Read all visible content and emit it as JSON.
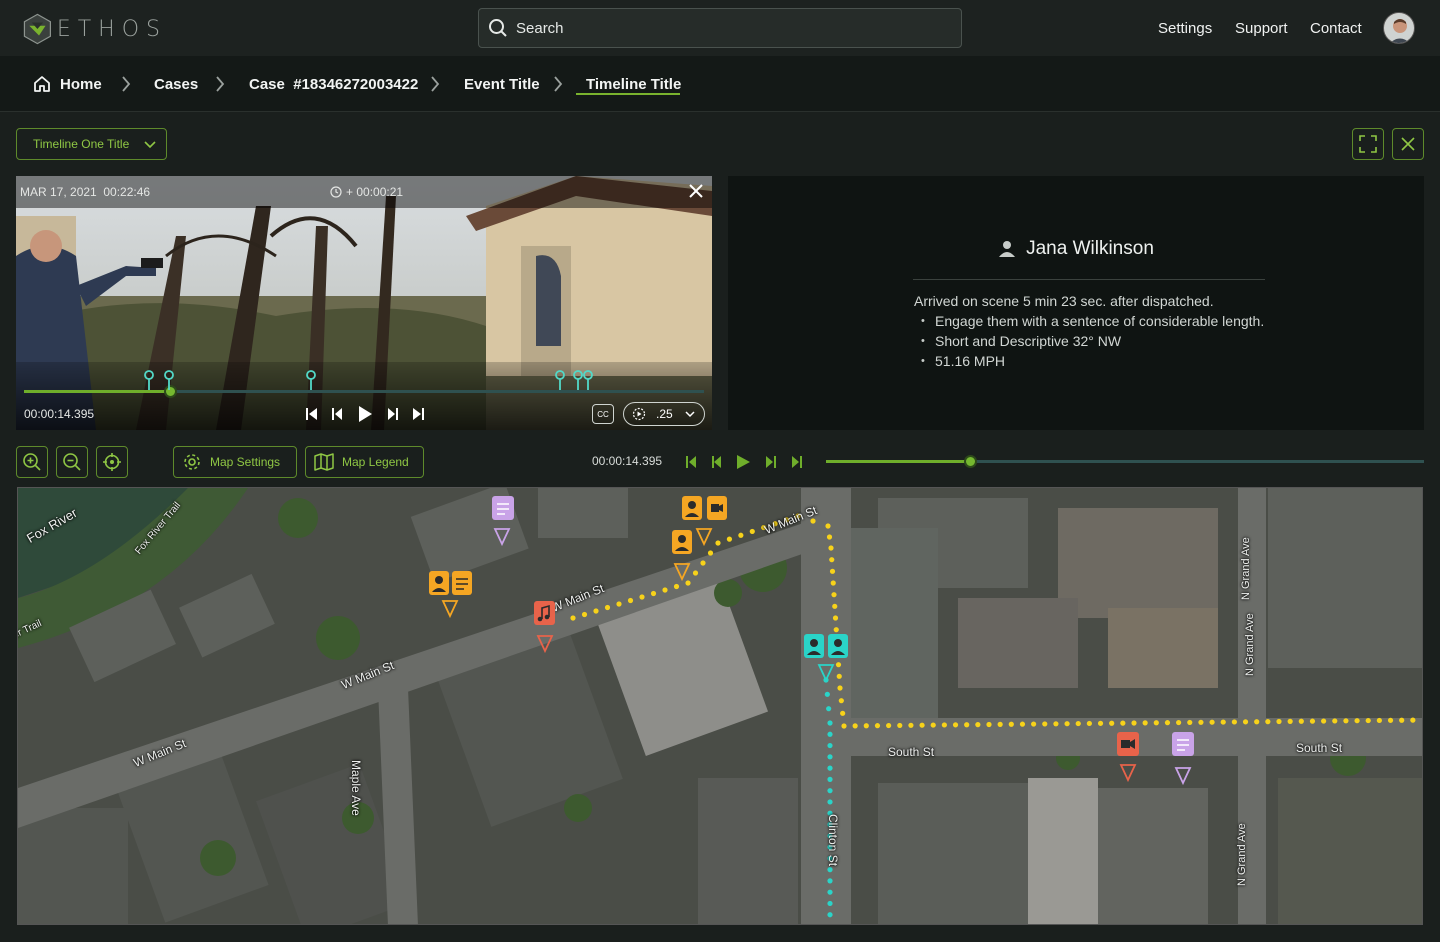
{
  "app": {
    "logo_text": "ETHOS"
  },
  "search": {
    "placeholder": "Search"
  },
  "topnav": {
    "settings": "Settings",
    "support": "Support",
    "contact": "Contact"
  },
  "breadcrumbs": {
    "home": "Home",
    "cases": "Cases",
    "case": "Case  #18346272003422",
    "event": "Event Title",
    "timeline": "Timeline Title"
  },
  "timeline_select": {
    "value": "Timeline One Title"
  },
  "video": {
    "timestamp": "MAR 17, 2021  00:22:46",
    "offset": "+ 00:00:21",
    "current_time": "00:00:14.395",
    "speed": ".25",
    "cc_label": "CC",
    "progress": 0.215
  },
  "info": {
    "name": "Jana Wilkinson",
    "summary": "Arrived on scene 5 min 23 sec. after dispatched.",
    "bullets": [
      "Engage them with a sentence of considerable length.",
      "Short and Descriptive 32° NW",
      "51.16 MPH"
    ]
  },
  "map_toolbar": {
    "settings_label": "Map Settings",
    "legend_label": "Map Legend",
    "time": "00:00:14.395",
    "progress": 0.24
  },
  "map": {
    "streets": {
      "fox_river": "Fox River",
      "fox_river_trail": "Fox River Trail",
      "trail_partial": "er Trail",
      "w_main_1": "W Main St",
      "w_main_2": "W Main St",
      "w_main_3": "W Main St",
      "w_main_4": "W Main St",
      "maple": "Maple Ave",
      "south_1": "South St",
      "south_2": "South St",
      "clinton": "Clinton St",
      "n_grand_1": "N Grand Ave",
      "n_grand_2": "N Grand Ave",
      "n_grand_3": "N Grand Ave"
    }
  },
  "colors": {
    "accent": "#7ab32e",
    "marker_orange": "#f5a623",
    "marker_red": "#e8634a",
    "marker_purple": "#c9a3e8",
    "marker_teal": "#2ad4c8",
    "route_yellow": "#f7d21a",
    "route_teal": "#2ad4c8"
  }
}
